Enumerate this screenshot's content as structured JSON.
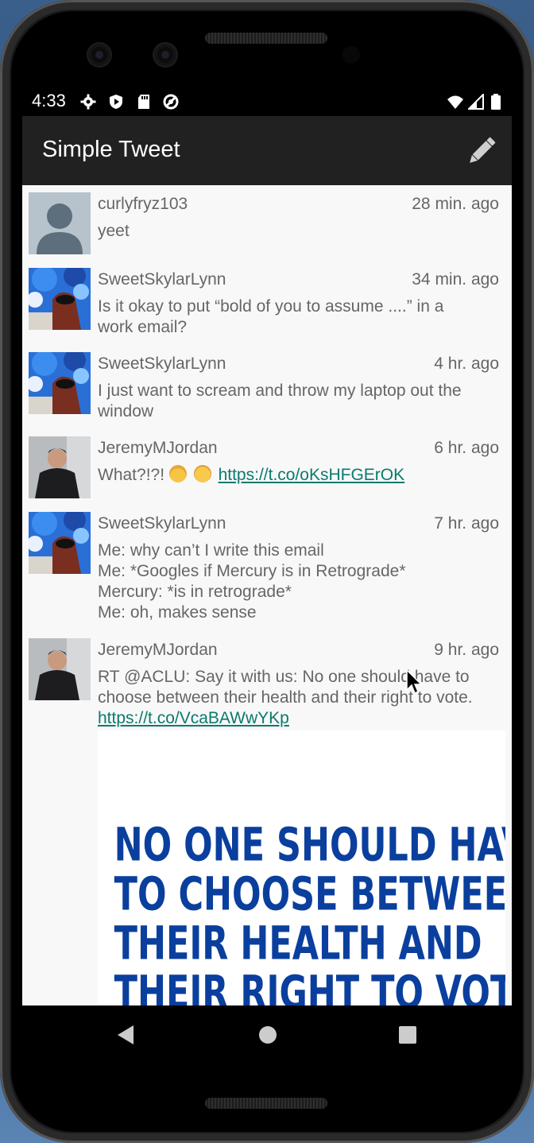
{
  "status_bar": {
    "time": "4:33",
    "left_icons": [
      "gear-icon",
      "shield-play-icon",
      "sd-card-icon",
      "at-sign-icon"
    ],
    "right_icons": [
      "wifi-icon",
      "signal-icon",
      "battery-icon"
    ]
  },
  "app_bar": {
    "title": "Simple Tweet",
    "compose_icon": "pencil-icon"
  },
  "tweets": [
    {
      "handle": "curlyfryz103",
      "time": "28 min. ago",
      "lines": [
        "yeet"
      ],
      "avatar": "default-avatar"
    },
    {
      "handle": "SweetSkylarLynn",
      "time": "34 min. ago",
      "lines": [
        "Is it okay to put “bold of you to assume ....” in a",
        "work email?"
      ],
      "avatar": "skylar-avatar"
    },
    {
      "handle": "SweetSkylarLynn",
      "time": "4 hr. ago",
      "lines": [
        "I just want to scream and throw my laptop out the",
        "window"
      ],
      "avatar": "skylar-avatar"
    },
    {
      "handle": "JeremyMJordan",
      "time": "6 hr. ago",
      "text_prefix": "What?!?! ",
      "emojis": [
        "exploding-head-emoji",
        "partying-face-emoji"
      ],
      "link": "https://t.co/oKsHFGErOK",
      "avatar": "jeremy-avatar"
    },
    {
      "handle": "SweetSkylarLynn",
      "time": "7 hr. ago",
      "lines": [
        "Me: why can’t I write this email",
        "Me: *Googles if Mercury is in Retrograde*",
        "Mercury: *is in retrograde*",
        "Me: oh, makes sense"
      ],
      "avatar": "skylar-avatar"
    },
    {
      "handle": "JeremyMJordan",
      "time": "9 hr. ago",
      "lines": [
        "RT @ACLU: Say it with us: No one should have to",
        "choose between their health and their right to vote."
      ],
      "link": "https://t.co/VcaBAWwYKp",
      "avatar": "jeremy-avatar"
    }
  ],
  "media": {
    "lines": [
      "NO ONE SHOULD HAVE",
      "TO CHOOSE BETWEEN",
      "THEIR HEALTH AND",
      "THEIR RIGHT TO VOTE."
    ],
    "color": "#0a3f9e"
  },
  "nav": [
    "back-icon",
    "home-icon",
    "recents-icon"
  ],
  "colors": {
    "app_bar": "#212121",
    "link": "#0b7a6e",
    "text": "#666666"
  }
}
